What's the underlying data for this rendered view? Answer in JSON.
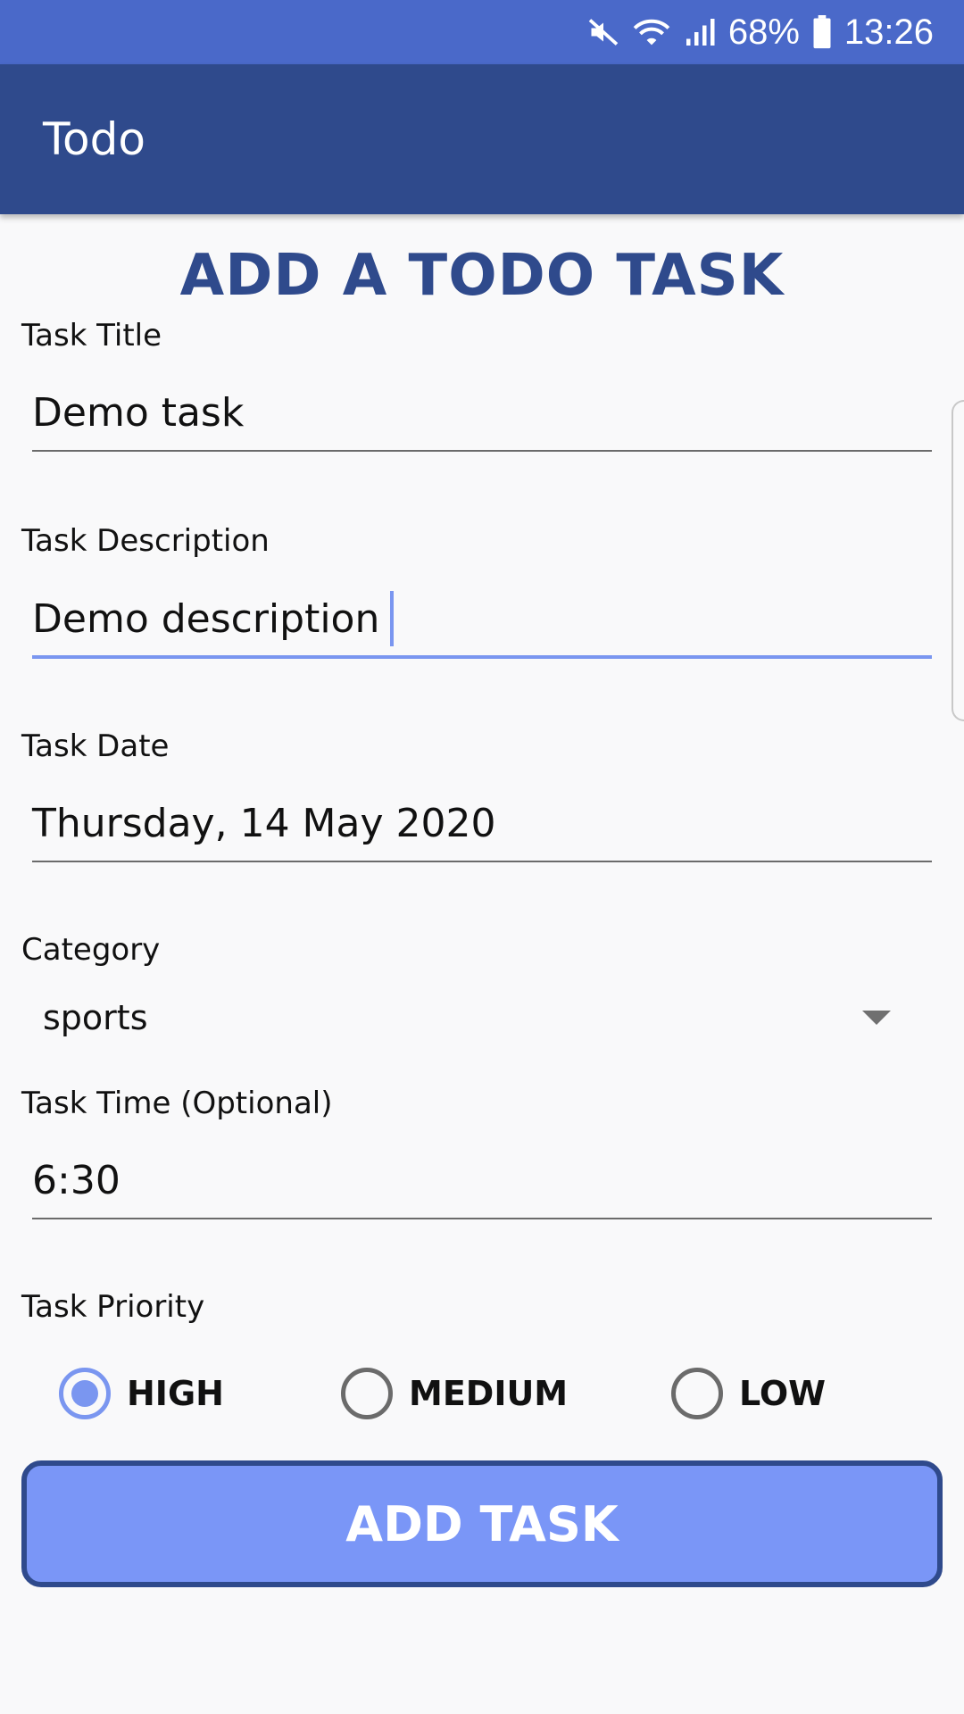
{
  "status_bar": {
    "battery": "68%",
    "time": "13:26",
    "icons": [
      "mute-icon",
      "wifi-icon",
      "signal-icon",
      "battery-icon"
    ]
  },
  "app_bar": {
    "title": "Todo"
  },
  "form": {
    "heading": "ADD A TODO TASK",
    "title_label": "Task Title",
    "title_value": "Demo task",
    "description_label": "Task Description",
    "description_value": "Demo description",
    "date_label": "Task Date",
    "date_value": "Thursday, 14 May 2020",
    "category_label": "Category",
    "category_value": "sports",
    "time_label": "Task Time (Optional)",
    "time_value": "6:30",
    "priority_label": "Task Priority",
    "priority_options": [
      {
        "label": "HIGH",
        "selected": true
      },
      {
        "label": "MEDIUM",
        "selected": false
      },
      {
        "label": "LOW",
        "selected": false
      }
    ],
    "submit_label": "ADD TASK"
  },
  "colors": {
    "status_bar": "#4a69c9",
    "app_bar": "#2f4a8c",
    "accent": "#7a96f0",
    "button": "#7a96f7"
  }
}
